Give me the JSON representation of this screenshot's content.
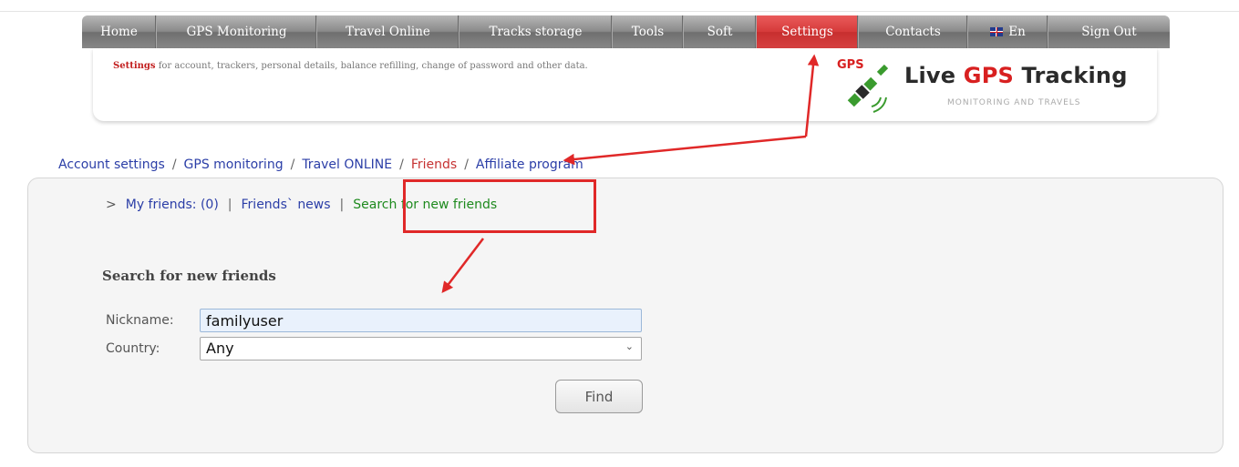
{
  "nav": {
    "items": [
      "Home",
      "GPS Monitoring",
      "Travel Online",
      "Tracks storage",
      "Tools",
      "Soft",
      "Settings",
      "Contacts",
      "En",
      "Sign Out"
    ],
    "active": "Settings",
    "active_color": "#d53a3a"
  },
  "header": {
    "desc_strong": "Settings",
    "desc_text": " for account, trackers, personal details, balance refilling, change of password and other data.",
    "logo_badge": "GPS",
    "logo_title_1": "Live ",
    "logo_title_gps": "GPS",
    "logo_title_2": " Tracking",
    "logo_subtitle": "MONITORING AND TRAVELS"
  },
  "breadcrumbs": [
    "Account settings",
    "GPS monitoring",
    "Travel ONLINE",
    "Friends",
    "Affiliate program"
  ],
  "breadcrumb_separator": "/",
  "subnav": {
    "marker": ">",
    "my_friends": "My friends: (0)",
    "friends_news": "Friends` news",
    "search_new": "Search for new friends",
    "separator": "|"
  },
  "form": {
    "title": "Search for new friends",
    "nickname_label": "Nickname:",
    "nickname_value": "familyuser",
    "country_label": "Country:",
    "country_value": "Any",
    "find_label": "Find"
  },
  "colors": {
    "link": "#2b3ea7",
    "current": "#c63232",
    "green_link": "#1e8a1e",
    "annotation_red": "#e02828"
  }
}
